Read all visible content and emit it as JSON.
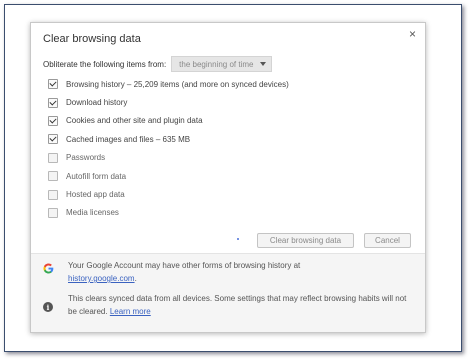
{
  "dialog": {
    "title": "Clear browsing data",
    "close_glyph": "×"
  },
  "period": {
    "label": "Obliterate the following items from:",
    "selected": "the beginning of time"
  },
  "options": [
    {
      "label": "Browsing history  –  25,209 items (and more on synced devices)",
      "checked": true
    },
    {
      "label": "Download history",
      "checked": true
    },
    {
      "label": "Cookies and other site and plugin data",
      "checked": true
    },
    {
      "label": "Cached images and files  –  635 MB",
      "checked": true
    },
    {
      "label": "Passwords",
      "checked": false
    },
    {
      "label": "Autofill form data",
      "checked": false
    },
    {
      "label": "Hosted app data",
      "checked": false
    },
    {
      "label": "Media licenses",
      "checked": false
    }
  ],
  "buttons": {
    "clear_label": "Clear browsing data",
    "cancel_label": "Cancel"
  },
  "footer": {
    "account_text": "Your Google Account may have other forms of browsing history at",
    "account_link": "history.google.com",
    "account_suffix": ".",
    "sync_text": "This clears synced data from all devices. Some settings that may reflect browsing habits will not be cleared.",
    "learn_more": "Learn more",
    "icons": [
      "google-g-icon",
      "info-icon"
    ]
  },
  "colors": {
    "link": "#3a62c0",
    "footer_bg": "#f5f5f5",
    "google_blue": "#4285f4",
    "google_red": "#ea4335",
    "google_yellow": "#fbbc05",
    "google_green": "#34a853"
  }
}
